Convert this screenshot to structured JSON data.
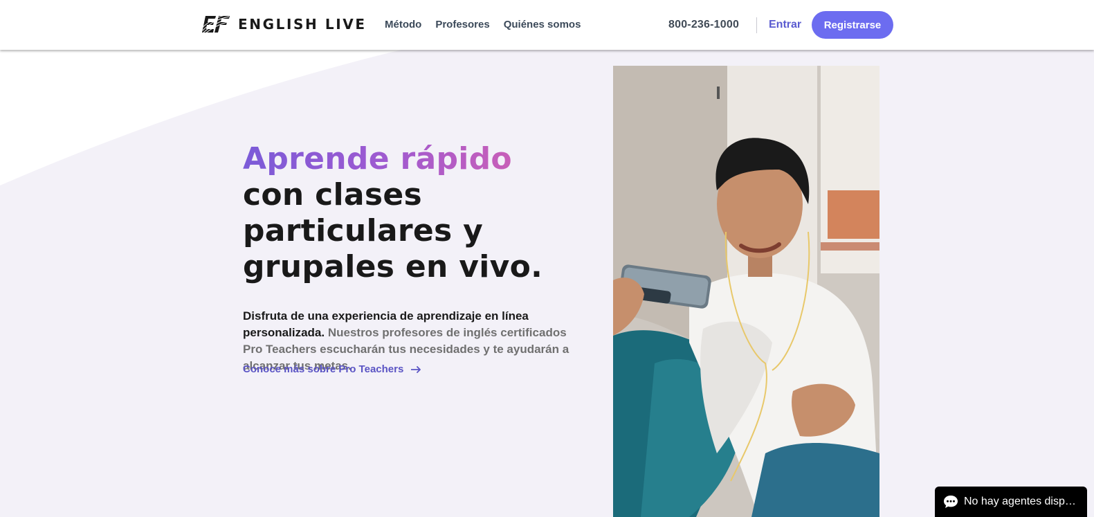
{
  "brand": {
    "name": "ENGLISH LIVE",
    "logo_icon": "ef-logo-icon"
  },
  "nav": {
    "items": [
      {
        "label": "Método"
      },
      {
        "label": "Profesores"
      },
      {
        "label": "Quiénes somos"
      }
    ]
  },
  "header": {
    "phone": "800-236-1000",
    "login_label": "Entrar",
    "signup_label": "Registrarse"
  },
  "hero": {
    "title_highlight": "Aprende rápido",
    "title_rest": " con clases particulares y grupales en vivo.",
    "description_strong": "Disfruta de una experiencia de aprendizaje en línea personalizada.",
    "description_rest": " Nuestros profesores de inglés certificados Pro Teachers escucharán tus necesidades y te ayudarán a alcanzar tus metas.",
    "link_label": "Conoce más sobre Pro Teachers",
    "link_icon": "arrow-right-icon"
  },
  "chat": {
    "label": "No hay agentes disp…",
    "icon": "chat-bubble-icon"
  },
  "colors": {
    "accent": "#6c6cf0",
    "link": "#5a54c4",
    "gradient_start": "#7b5bd8",
    "gradient_end": "#c85fb8",
    "page_background": "#f3f1f8"
  }
}
